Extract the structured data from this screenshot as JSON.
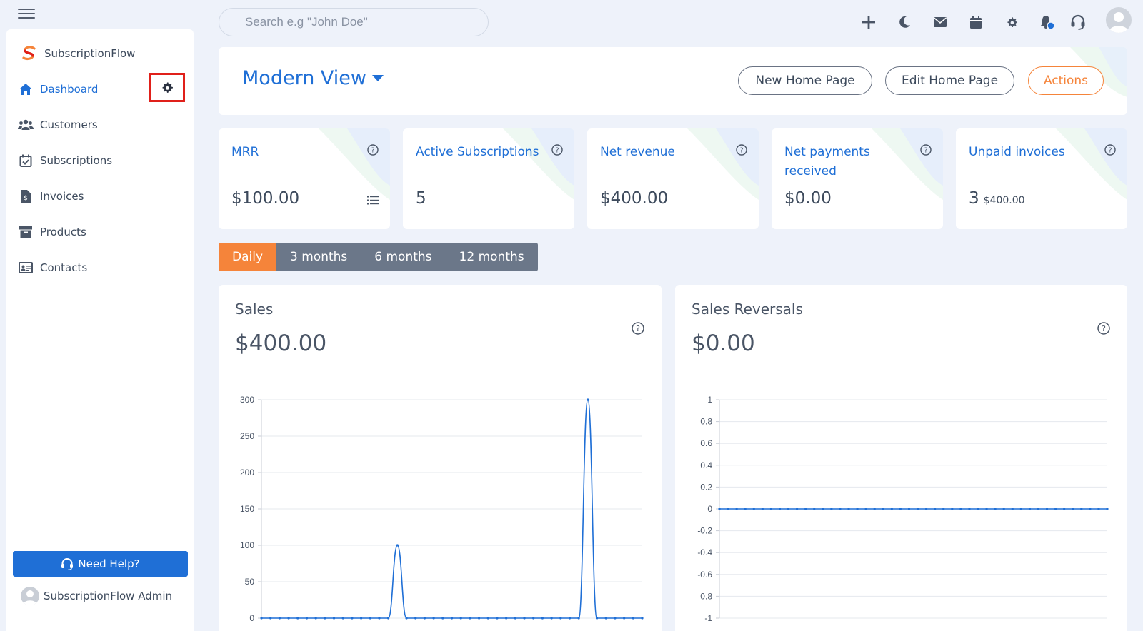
{
  "app": {
    "name": "SubscriptionFlow"
  },
  "search": {
    "placeholder": "Search e.g \"John Doe\""
  },
  "sidebar": {
    "items": [
      {
        "label": "Dashboard",
        "icon": "home-icon",
        "active": true
      },
      {
        "label": "Customers",
        "icon": "users-icon"
      },
      {
        "label": "Subscriptions",
        "icon": "calendar-check-icon"
      },
      {
        "label": "Invoices",
        "icon": "invoice-icon"
      },
      {
        "label": "Products",
        "icon": "archive-icon"
      },
      {
        "label": "Contacts",
        "icon": "contact-card-icon"
      }
    ],
    "help_label": "Need Help?",
    "user_name": "SubscriptionFlow Admin"
  },
  "header": {
    "title": "Modern View",
    "buttons": {
      "new_home": "New Home Page",
      "edit_home": "Edit Home Page",
      "actions": "Actions"
    }
  },
  "kpis": [
    {
      "label": "MRR",
      "value": "$100.00"
    },
    {
      "label": "Active Subscriptions",
      "value": "5"
    },
    {
      "label": "Net revenue",
      "value": "$400.00"
    },
    {
      "label": "Net payments received",
      "value": "$0.00"
    },
    {
      "label": "Unpaid invoices",
      "value": "3",
      "sub": "$400.00"
    }
  ],
  "ranges": [
    "Daily",
    "3 months",
    "6 months",
    "12 months"
  ],
  "selected_range": "Daily",
  "panels": {
    "sales": {
      "title": "Sales",
      "value": "$400.00"
    },
    "reversals": {
      "title": "Sales Reversals",
      "value": "$0.00"
    }
  },
  "colors": {
    "primary": "#1f6fd6",
    "accent": "#f5843a",
    "highlight": "#e0201a"
  },
  "chart_data": [
    {
      "type": "line",
      "ylim": [
        0,
        300
      ],
      "yticks": [
        "0",
        "50",
        "100",
        "150",
        "200",
        "250",
        "300"
      ],
      "series": [
        {
          "values": [
            0,
            0,
            0,
            0,
            0,
            0,
            0,
            0,
            0,
            0,
            0,
            0,
            0,
            0,
            0,
            100,
            0,
            0,
            0,
            0,
            0,
            0,
            0,
            0,
            0,
            0,
            0,
            0,
            0,
            0,
            0,
            0,
            0,
            0,
            0,
            0,
            300,
            0,
            0,
            0,
            0,
            0,
            0
          ]
        }
      ]
    },
    {
      "type": "line",
      "ylim": [
        -1,
        1
      ],
      "yticks": [
        "-1",
        "-0.8",
        "-0.6",
        "-0.4",
        "-0.2",
        "0",
        "0.2",
        "0.4",
        "0.6",
        "0.8",
        "1"
      ],
      "series": [
        {
          "values": [
            0,
            0,
            0,
            0,
            0,
            0,
            0,
            0,
            0,
            0,
            0,
            0,
            0,
            0,
            0,
            0,
            0,
            0,
            0,
            0,
            0,
            0,
            0,
            0,
            0,
            0,
            0,
            0,
            0,
            0,
            0,
            0,
            0,
            0,
            0,
            0,
            0,
            0,
            0,
            0,
            0,
            0,
            0,
            0,
            0,
            0
          ]
        }
      ]
    }
  ]
}
